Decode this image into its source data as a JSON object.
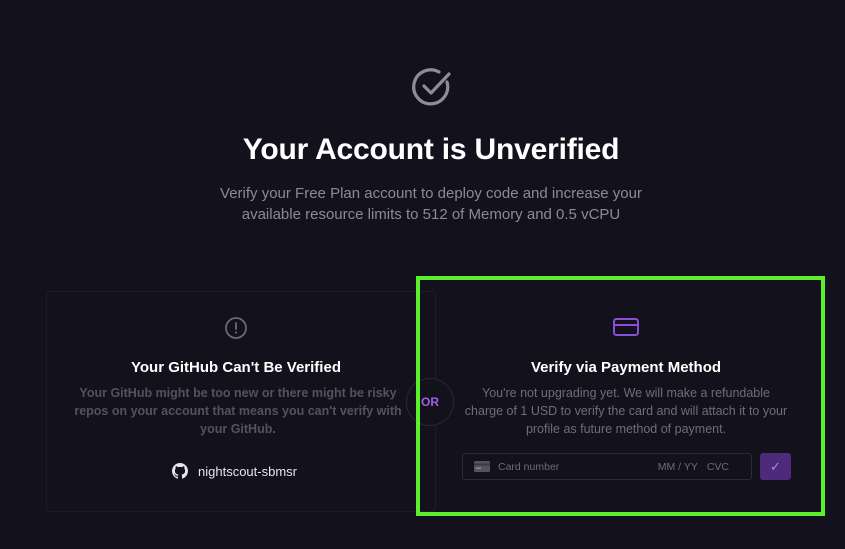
{
  "header": {
    "icon": "check-circle-icon",
    "title": "Your Account is Unverified",
    "subtitle": "Verify your Free Plan account to deploy code and increase your available resource limits to 512 of Memory and 0.5 vCPU"
  },
  "github_card": {
    "icon": "alert-circle-icon",
    "title": "Your GitHub Can't Be Verified",
    "description": "Your GitHub might be too new or there might be risky repos on your account that means you can't verify with your GitHub.",
    "username_icon": "github-icon",
    "username": "nightscout-sbmsr"
  },
  "divider": {
    "label": "OR"
  },
  "payment_card": {
    "icon": "credit-card-icon",
    "title": "Verify via Payment Method",
    "description": "You're not upgrading yet. We will make a refundable charge of 1 USD to verify the card and will attach it to your profile as future method of payment.",
    "card_input": {
      "icon": "card-brand-icon",
      "placeholder": "Card number",
      "expiry_placeholder": "MM / YY",
      "cvc_placeholder": "CVC"
    },
    "submit_icon": "checkmark-icon",
    "submit_label": "✓"
  },
  "colors": {
    "background": "#13111c",
    "accent": "#9e60e8",
    "highlight": "#5af02c"
  }
}
